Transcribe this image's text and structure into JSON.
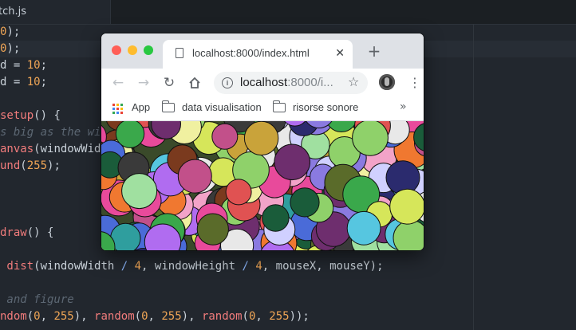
{
  "editor": {
    "tab_label": "tch.js",
    "code_lines": [
      {
        "parts": [
          {
            "t": "0",
            "c": "n"
          },
          {
            "t": ");",
            "c": ""
          }
        ]
      },
      {
        "parts": [
          {
            "t": "0",
            "c": "n"
          },
          {
            "t": ");",
            "c": ""
          }
        ]
      },
      {
        "parts": [
          {
            "t": "d = ",
            "c": ""
          },
          {
            "t": "10",
            "c": "n"
          },
          {
            "t": ";",
            "c": ""
          }
        ]
      },
      {
        "parts": [
          {
            "t": "d = ",
            "c": ""
          },
          {
            "t": "10",
            "c": "n"
          },
          {
            "t": ";",
            "c": ""
          }
        ]
      },
      {
        "parts": []
      },
      {
        "parts": [
          {
            "t": "setup",
            "c": "k"
          },
          {
            "t": "() {",
            "c": ""
          }
        ]
      },
      {
        "parts": [
          {
            "t": "s big as the win",
            "c": "c"
          }
        ]
      },
      {
        "parts": [
          {
            "t": "anvas",
            "c": "k"
          },
          {
            "t": "(windowWidt",
            "c": ""
          }
        ]
      },
      {
        "parts": [
          {
            "t": "und",
            "c": "k"
          },
          {
            "t": "(",
            "c": ""
          },
          {
            "t": "255",
            "c": "n"
          },
          {
            "t": ");",
            "c": ""
          }
        ]
      },
      {
        "parts": []
      },
      {
        "parts": []
      },
      {
        "parts": []
      },
      {
        "parts": [
          {
            "t": "draw",
            "c": "k"
          },
          {
            "t": "() {",
            "c": ""
          }
        ]
      },
      {
        "parts": []
      },
      {
        "parts": [
          {
            "t": " dist",
            "c": "k"
          },
          {
            "t": "(windowWidth ",
            "c": ""
          },
          {
            "t": "/",
            "c": "o"
          },
          {
            "t": " ",
            "c": ""
          },
          {
            "t": "4",
            "c": "n"
          },
          {
            "t": ", windowHeight ",
            "c": ""
          },
          {
            "t": "/",
            "c": "o"
          },
          {
            "t": " ",
            "c": ""
          },
          {
            "t": "4",
            "c": "n"
          },
          {
            "t": ", mouseX, mouseY);",
            "c": ""
          }
        ]
      },
      {
        "parts": []
      },
      {
        "parts": [
          {
            "t": " and figure",
            "c": "c"
          }
        ]
      },
      {
        "parts": [
          {
            "t": "ndom",
            "c": "k"
          },
          {
            "t": "(",
            "c": ""
          },
          {
            "t": "0",
            "c": "n"
          },
          {
            "t": ", ",
            "c": ""
          },
          {
            "t": "255",
            "c": "n"
          },
          {
            "t": "), ",
            "c": ""
          },
          {
            "t": "random",
            "c": "k"
          },
          {
            "t": "(",
            "c": ""
          },
          {
            "t": "0",
            "c": "n"
          },
          {
            "t": ", ",
            "c": ""
          },
          {
            "t": "255",
            "c": "n"
          },
          {
            "t": "), ",
            "c": ""
          },
          {
            "t": "random",
            "c": "k"
          },
          {
            "t": "(",
            "c": ""
          },
          {
            "t": "0",
            "c": "n"
          },
          {
            "t": ", ",
            "c": ""
          },
          {
            "t": "255",
            "c": "n"
          },
          {
            "t": "));",
            "c": ""
          }
        ]
      }
    ]
  },
  "browser": {
    "tab_title": "localhost:8000/index.html",
    "tab_close_icon": "close-icon",
    "new_tab_icon": "plus-icon",
    "url_host": "localhost",
    "url_rest": ":8000/i...",
    "nav_icons": [
      "back-arrow-icon",
      "forward-arrow-icon",
      "reload-icon",
      "home-icon"
    ],
    "bookmarks": [
      {
        "label": "App",
        "icon": "apps-grid-icon"
      },
      {
        "label": "data visualisation",
        "icon": "folder-icon"
      },
      {
        "label": "risorse sonore",
        "icon": "folder-icon"
      }
    ],
    "overflow_icon": "double-chevron-icon",
    "canvas_palette": [
      "#e84a9b",
      "#3aa84b",
      "#8a7ae0",
      "#d6e65a",
      "#2f9e9e",
      "#c2508a",
      "#5a6b2a",
      "#f0f0a0",
      "#4a6bd8",
      "#e05252",
      "#8fd16a",
      "#2b2b6e",
      "#f2a3c8",
      "#7a3a1e",
      "#56c6e0",
      "#c9a33a",
      "#6e2e6e",
      "#a0e0a0",
      "#3a3a3a",
      "#e8e8e8",
      "#b06cf0",
      "#1a5c3a",
      "#f07830",
      "#d0d0ff"
    ]
  }
}
